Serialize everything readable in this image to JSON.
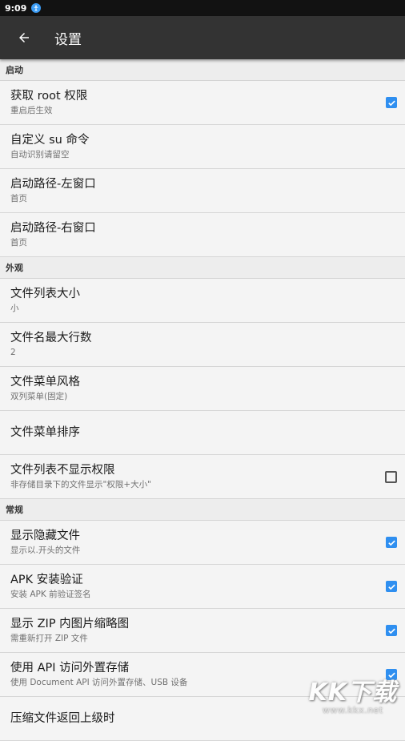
{
  "status_bar": {
    "time": "9:09",
    "icon": "accessibility-icon"
  },
  "toolbar": {
    "title": "设置",
    "back_icon": "arrow-back-icon"
  },
  "sections": {
    "startup": {
      "header": "启动",
      "items": [
        {
          "title": "获取 root 权限",
          "subtitle": "重启后生效",
          "checkbox": true
        },
        {
          "title": "自定义 su 命令",
          "subtitle": "自动识别请留空"
        },
        {
          "title": "启动路径-左窗口",
          "subtitle": "首页"
        },
        {
          "title": "启动路径-右窗口",
          "subtitle": "首页"
        }
      ]
    },
    "appearance": {
      "header": "外观",
      "items": [
        {
          "title": "文件列表大小",
          "subtitle": "小"
        },
        {
          "title": "文件名最大行数",
          "subtitle": "2"
        },
        {
          "title": "文件菜单风格",
          "subtitle": "双列菜单(固定)"
        },
        {
          "title": "文件菜单排序",
          "subtitle": ""
        },
        {
          "title": "文件列表不显示权限",
          "subtitle": "非存储目录下的文件显示\"权限+大小\"",
          "checkbox": false
        }
      ]
    },
    "general": {
      "header": "常规",
      "items": [
        {
          "title": "显示隐藏文件",
          "subtitle": "显示以.开头的文件",
          "checkbox": true
        },
        {
          "title": "APK 安装验证",
          "subtitle": "安装 APK 前验证签名",
          "checkbox": true
        },
        {
          "title": "显示 ZIP 内图片缩略图",
          "subtitle": "需重新打开 ZIP 文件",
          "checkbox": true
        },
        {
          "title": "使用 API 访问外置存储",
          "subtitle": "使用 Document API 访问外置存储、USB 设备",
          "checkbox": true
        },
        {
          "title": "压缩文件返回上级时",
          "subtitle": ""
        }
      ]
    }
  },
  "watermark": {
    "logo": "KK下载",
    "url": "www.kkx.net"
  },
  "colors": {
    "accent": "#2f8ff0",
    "toolbar": "#333333",
    "status_bar": "#121212",
    "background": "#ededed"
  }
}
